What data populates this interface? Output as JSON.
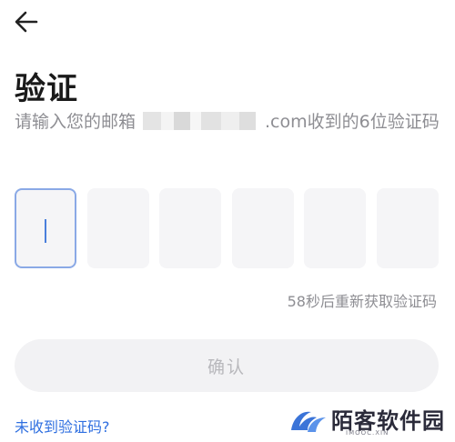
{
  "header": {
    "back_icon": "arrow-left-icon",
    "title": "验证"
  },
  "subtitle": {
    "prefix": "请输入您的邮箱",
    "suffix": ".com收到的6位验证码"
  },
  "code_input": {
    "length": 6,
    "active_index": 0,
    "values": [
      "",
      "",
      "",
      "",
      "",
      ""
    ]
  },
  "resend_text": "58秒后重新获取验证码",
  "confirm_label": "确认",
  "help_link": "未收到验证码?",
  "watermark": {
    "text": "陌客软件园",
    "sub": "IMOOC.XIN"
  },
  "colors": {
    "accent": "#2f6fe0",
    "active_border": "#8aa9e6",
    "muted_text": "#8e8e93",
    "input_bg": "#f5f5f7"
  }
}
